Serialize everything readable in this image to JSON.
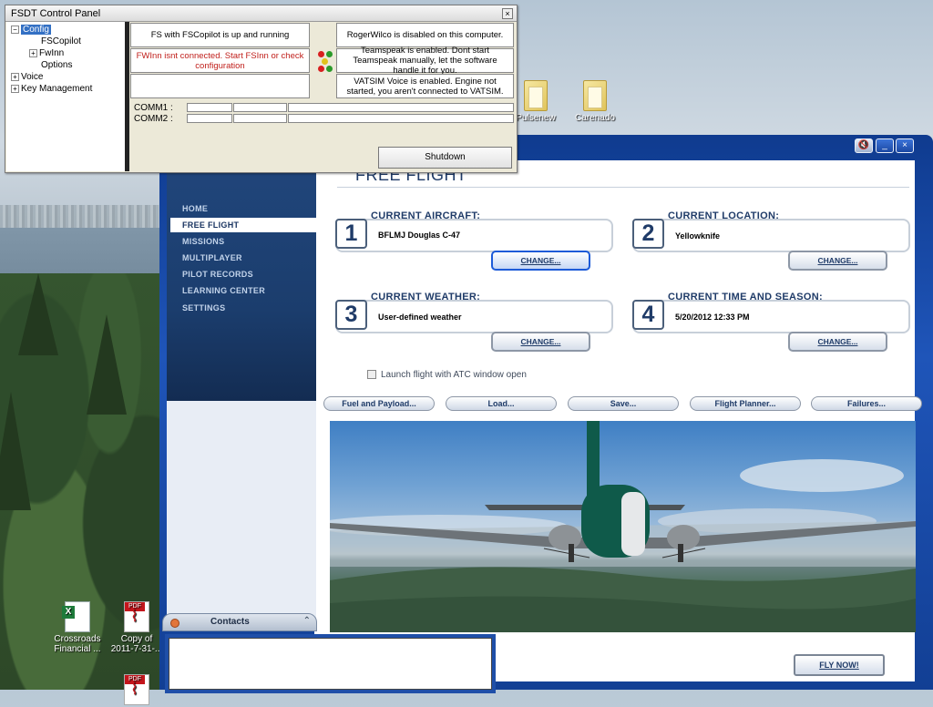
{
  "desktop": {
    "icons": [
      {
        "label": "Pulsenew",
        "type": "folder"
      },
      {
        "label": "Carenado",
        "type": "folder"
      },
      {
        "label": "Crossroads Financial ...",
        "type": "excel"
      },
      {
        "label": "Copy of 2011-7-31-...",
        "type": "pdf"
      }
    ]
  },
  "fsdt": {
    "title": "FSDT Control Panel",
    "close_glyph": "×",
    "tree": {
      "config": "Config",
      "fscopilot": "FSCopilot",
      "fwinn": "FwInn",
      "options": "Options",
      "voice": "Voice",
      "key_management": "Key Management"
    },
    "status": {
      "fs": "FS with FSCopilot is up and running",
      "rogerwilco": "RogerWilco is disabled on this computer.",
      "fwinn": "FWInn isnt connected. Start FSInn or check configuration",
      "teamspeak": "Teamspeak is enabled. Dont start Teamspeak manually, let the software handle it for you.",
      "vatsim": "VATSIM Voice is enabled. Engine not started, you aren't connected to VATSIM."
    },
    "comm1_label": "COMM1 :",
    "comm2_label": "COMM2 :",
    "shutdown": "Shutdown",
    "status_colors": {
      "red": "#d81f1f",
      "green": "#2a9a2a",
      "yellow": "#e0c31c"
    }
  },
  "fsx": {
    "nav": {
      "home": "HOME",
      "free_flight": "FREE FLIGHT",
      "missions": "MISSIONS",
      "multiplayer": "MULTIPLAYER",
      "pilot_records": "PILOT RECORDS",
      "learning_center": "LEARNING CENTER",
      "settings": "SETTINGS"
    },
    "window_controls": {
      "sound": "🔇",
      "minimize": "_",
      "close": "×"
    },
    "page_title": "FREE FLIGHT",
    "cards": {
      "aircraft": {
        "num": "1",
        "heading": "CURRENT AIRCRAFT:",
        "value": "BFLMJ Douglas C-47",
        "change": "CHANGE..."
      },
      "location": {
        "num": "2",
        "heading": "CURRENT LOCATION:",
        "value": "Yellowknife",
        "change": "CHANGE..."
      },
      "weather": {
        "num": "3",
        "heading": "CURRENT WEATHER:",
        "value": "User-defined weather",
        "change": "CHANGE..."
      },
      "time": {
        "num": "4",
        "heading": "CURRENT TIME AND SEASON:",
        "value": "5/20/2012 12:33 PM",
        "change": "CHANGE..."
      }
    },
    "atc_checkbox": "Launch flight with ATC window open",
    "actions": {
      "fuel": "Fuel and Payload...",
      "load": "Load...",
      "save": "Save...",
      "planner": "Flight Planner...",
      "failures": "Failures..."
    },
    "fly_now": "FLY NOW!"
  },
  "contacts": {
    "label": "Contacts",
    "collapse_glyph": "⌃"
  }
}
